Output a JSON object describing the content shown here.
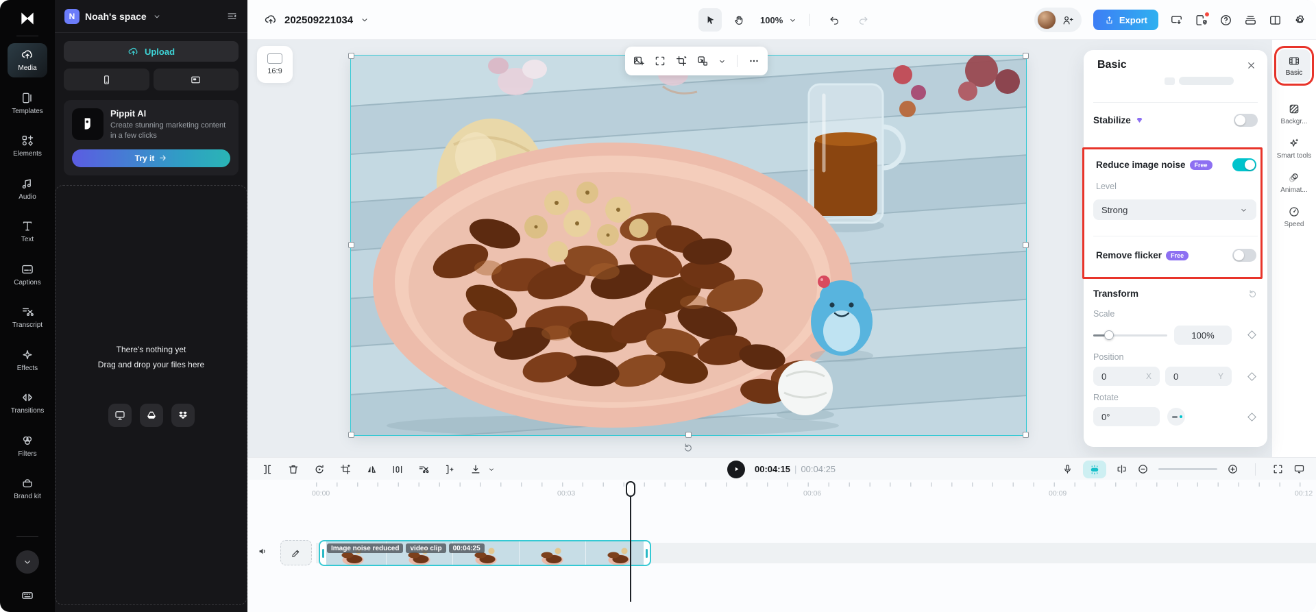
{
  "workspace": {
    "name": "Noah's space",
    "avatar_initial": "N"
  },
  "left_rail": {
    "items": [
      "Media",
      "Templates",
      "Elements",
      "Audio",
      "Text",
      "Captions",
      "Transcript",
      "Effects",
      "Transitions",
      "Filters",
      "Brand kit"
    ]
  },
  "media_panel": {
    "upload_label": "Upload",
    "pippit": {
      "title": "Pippit AI",
      "description": "Create stunning marketing content in a few clicks",
      "cta": "Try it"
    },
    "empty_state": {
      "line1": "There's nothing yet",
      "line2": "Drag and drop your files here"
    }
  },
  "top_bar": {
    "project_name": "202509221034",
    "zoom_level": "100%",
    "export_label": "Export"
  },
  "canvas": {
    "aspect_ratio": "16:9"
  },
  "inspector": {
    "title": "Basic",
    "stabilize_label": "Stabilize",
    "reduce_noise_label": "Reduce image noise",
    "free_badge": "Free",
    "level_label": "Level",
    "level_value": "Strong",
    "remove_flicker_label": "Remove flicker",
    "transform": {
      "title": "Transform",
      "scale_label": "Scale",
      "scale_value": "100%",
      "position_label": "Position",
      "position_x": "0",
      "position_x_unit": "X",
      "position_y": "0",
      "position_y_unit": "Y",
      "rotate_label": "Rotate",
      "rotate_value": "0°"
    }
  },
  "right_rail": {
    "items": [
      "Basic",
      "Backgr...",
      "Smart tools",
      "Animat...",
      "Speed"
    ]
  },
  "playback": {
    "current_time": "00:04:15",
    "separator": "|",
    "total_time": "00:04:25"
  },
  "timeline": {
    "ruler": [
      "00:00",
      "00:03",
      "00:06",
      "00:09",
      "00:12"
    ],
    "clip": {
      "label": "Image noise reduced",
      "type": "video clip",
      "duration": "00:04:25"
    }
  },
  "colors": {
    "accent_teal": "#00c3cc",
    "highlight_red": "#e8342a",
    "export_blue": "#3d7ef5",
    "free_badge_purple": "#8d70f2"
  }
}
